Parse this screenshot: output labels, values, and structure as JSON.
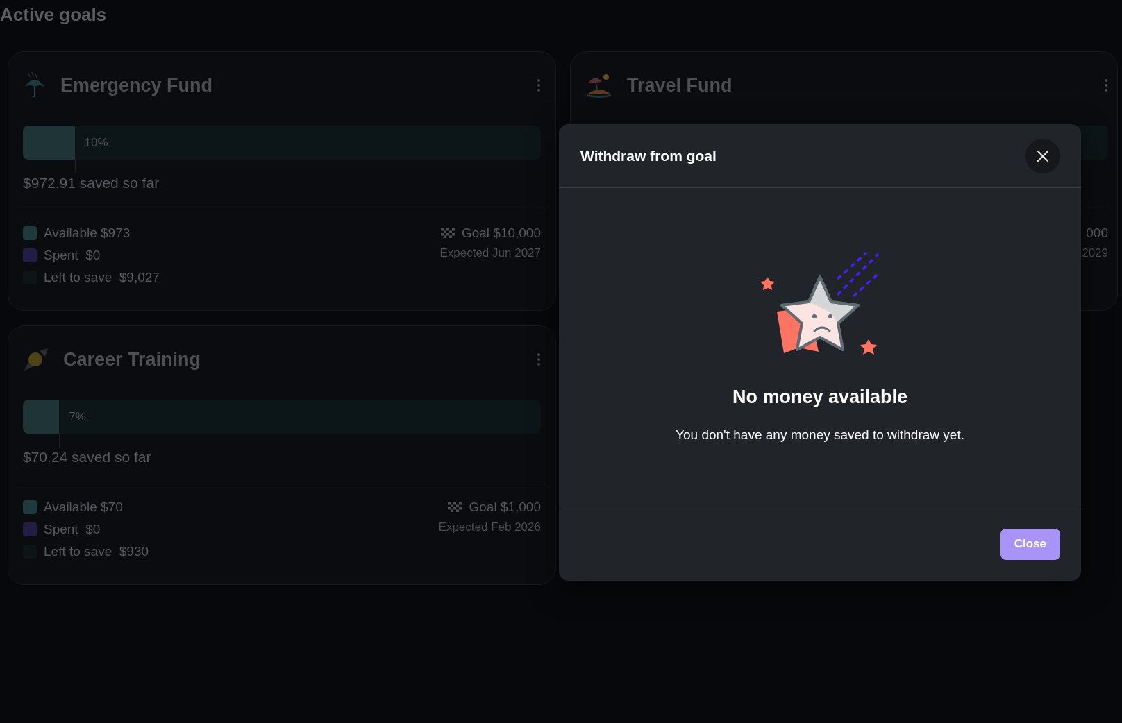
{
  "page_title": "Active goals",
  "goals": [
    {
      "name": "Emergency Fund",
      "kind": "umbrella",
      "level": 0.1,
      "percent": "10%",
      "saved": "$972.91 saved so far",
      "legend": [
        {
          "label": "Available $973",
          "color": "#1f3a3c"
        },
        {
          "label": "Spent  $0",
          "color": "#231c45"
        },
        {
          "label": "Left to save  $9,027",
          "color": "#0e1516"
        }
      ],
      "goal": "Goal $10,000",
      "expected": "Expected Jun 2027"
    },
    {
      "name": "Travel Fund",
      "kind": "beach",
      "goal": "000",
      "expected": "2029"
    },
    {
      "name": "Career Training",
      "kind": "rocket",
      "level": 0.07,
      "percent": "7%",
      "saved": "$70.24 saved so far",
      "legend": [
        {
          "label": "Available $70",
          "color": "#1f3a3c"
        },
        {
          "label": "Spent  $0",
          "color": "#231c45"
        },
        {
          "label": "Left to save  $930",
          "color": "#0e1516"
        }
      ],
      "goal": "Goal $1,000",
      "expected": "Expected Feb 2026"
    }
  ],
  "dialog": {
    "title": "Withdraw from goal",
    "heading": "No money available",
    "message": "You don't have any money saved to withdraw yet.",
    "button": "Close"
  }
}
